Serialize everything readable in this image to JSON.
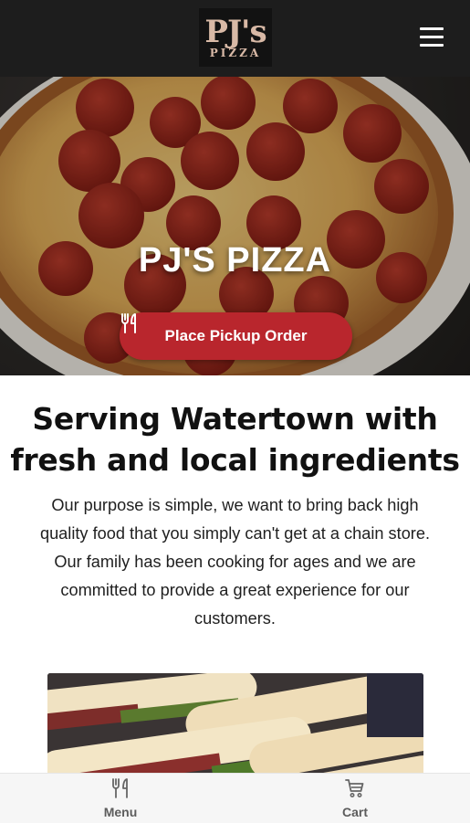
{
  "header": {
    "logo": {
      "main": "PJ's",
      "sub": "PIZZA"
    },
    "menu_icon": "hamburger-menu-icon"
  },
  "hero": {
    "title": "PJ'S PIZZA",
    "order_button": {
      "label": "Place Pickup Order",
      "icon": "fork-knife-icon"
    }
  },
  "intro": {
    "headline_line1": "Serving Watertown with",
    "headline_line2": "fresh and local ingredients",
    "body_lines": [
      "Our purpose is simple, we want to bring back high",
      "quality food that you simply can't get at a chain store.",
      "Our family has been cooking for ages and we are",
      "committed to provide a great experience for our",
      "customers."
    ]
  },
  "bottom_nav": {
    "items": [
      {
        "label": "Menu",
        "icon": "fork-knife-icon"
      },
      {
        "label": "Cart",
        "icon": "cart-icon"
      }
    ]
  },
  "colors": {
    "topbar": "#1d1d1d",
    "accent_red": "#b9262d",
    "logo_text": "#d8b9a6"
  }
}
